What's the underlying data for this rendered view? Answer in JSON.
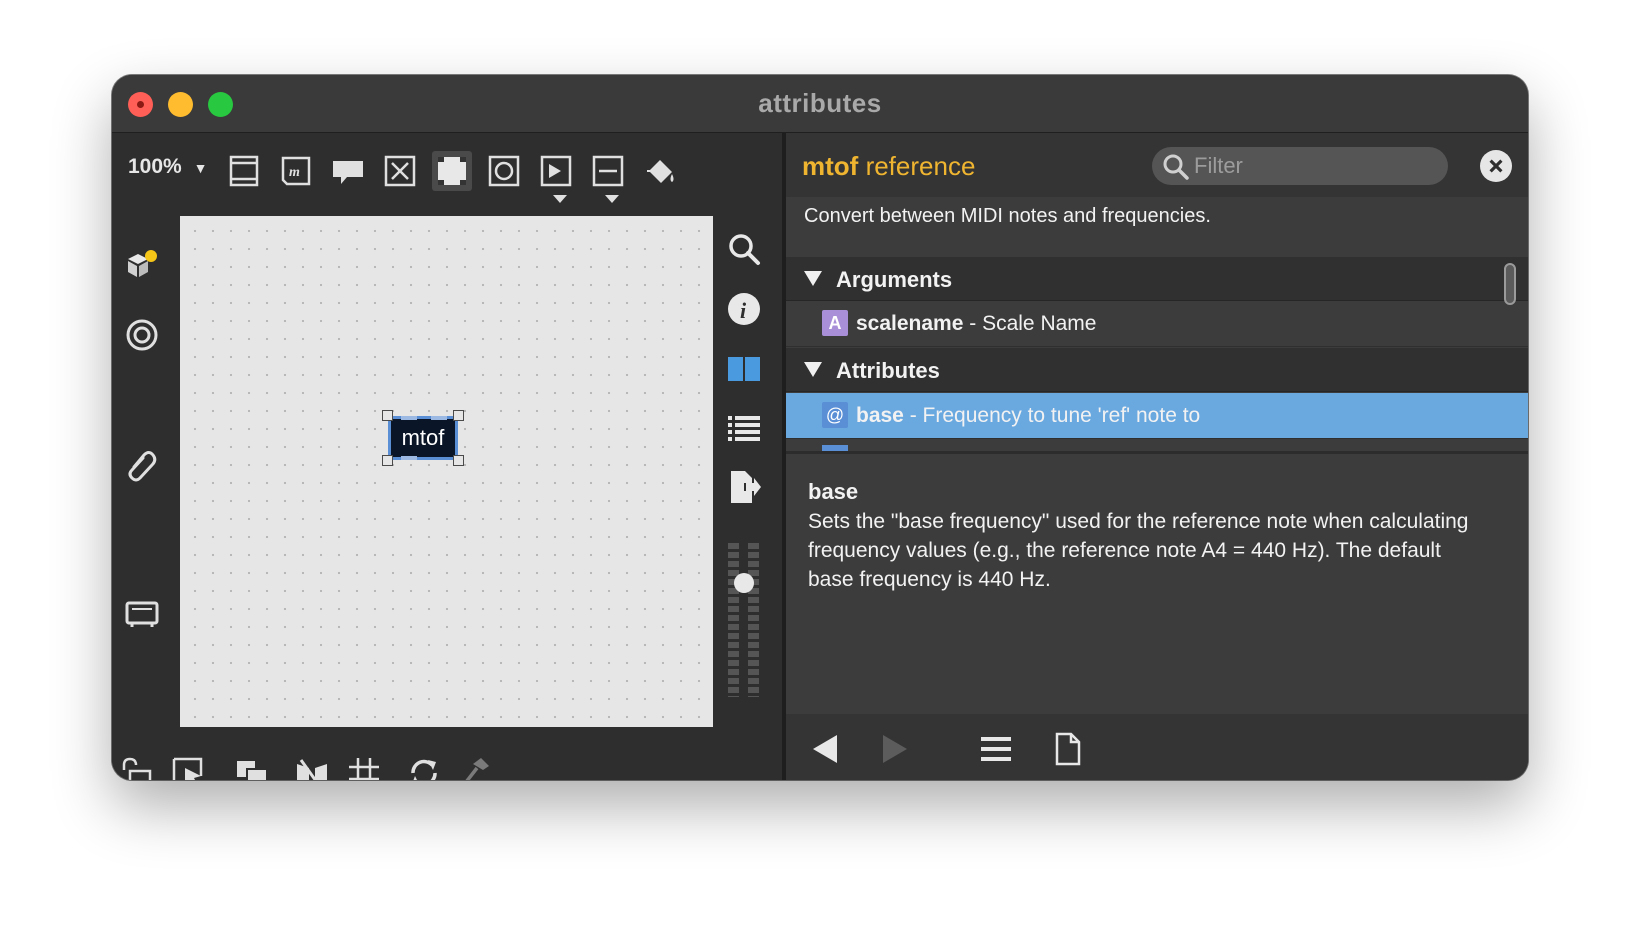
{
  "window": {
    "title": "attributes"
  },
  "toolbar": {
    "zoom": "100%",
    "icons": [
      "presentation-icon",
      "message-icon",
      "comment-icon",
      "toggle-icon",
      "inlet-icon",
      "button-icon",
      "play-icon",
      "slider-icon",
      "paint-bucket-icon"
    ]
  },
  "patcher": {
    "object": {
      "label": "mtof"
    }
  },
  "reference": {
    "object_name": "mtof",
    "title_suffix": "reference",
    "filter_placeholder": "Filter",
    "description": "Convert between MIDI notes and frequencies.",
    "arguments_label": "Arguments",
    "arguments": [
      {
        "badge": "A",
        "name": "scalename",
        "desc": " - Scale Name",
        "badge_color": "#a98fd8"
      }
    ],
    "attributes_label": "Attributes",
    "attributes": [
      {
        "badge": "@",
        "name": "base",
        "desc": " - Frequency to tune 'ref' note to",
        "badge_color": "#5a8fd6",
        "selected": true
      }
    ],
    "detail": {
      "name": "base",
      "text": "Sets the \"base frequency\" used for the reference note when calculating frequency values (e.g., the reference note A4 = 440 Hz). The default base frequency is 440 Hz."
    }
  },
  "colors": {
    "accent_title": "#f0b530",
    "selection": "#6aa8e0",
    "object_border": "#5a8fd6"
  }
}
